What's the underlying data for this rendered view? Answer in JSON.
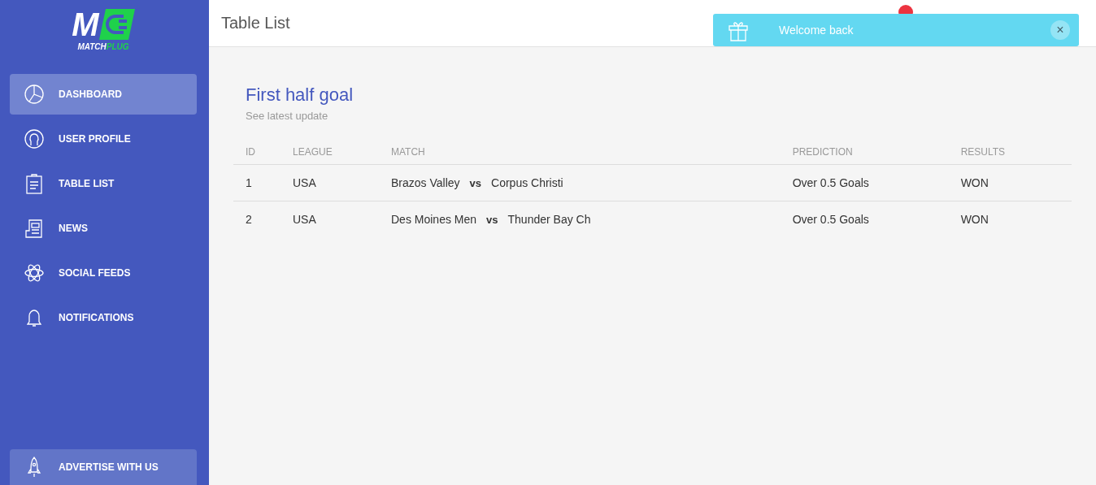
{
  "logo": {
    "mark": "M",
    "name_a": "MATCH",
    "name_b": "PLUG"
  },
  "sidebar": {
    "items": [
      {
        "label": "DASHBOARD",
        "kind": "chart",
        "selected": true
      },
      {
        "label": "USER PROFILE",
        "kind": "user",
        "selected": false
      },
      {
        "label": "TABLE LIST",
        "kind": "clipboard",
        "selected": false
      },
      {
        "label": "NEWS",
        "kind": "news",
        "selected": false
      },
      {
        "label": "SOCIAL FEEDS",
        "kind": "atom",
        "selected": false
      },
      {
        "label": "NOTIFICATIONS",
        "kind": "bell",
        "selected": false
      }
    ],
    "footer_button": {
      "label": "ADVERTISE WITH US"
    }
  },
  "header": {
    "title": "Table List"
  },
  "toast": {
    "message": "Welcome back",
    "close": "×"
  },
  "card": {
    "title": "First half goal",
    "subtitle": "See latest update",
    "table": {
      "columns": [
        "ID",
        "LEAGUE",
        "MATCH",
        "PREDICTION",
        "RESULTS"
      ],
      "rows": [
        {
          "id": "1",
          "league": "USA",
          "home": "Brazos Valley",
          "vs": "vs",
          "away": "Corpus Christi",
          "prediction": "Over 0.5 Goals",
          "result": "WON"
        },
        {
          "id": "2",
          "league": "USA",
          "home": "Des Moines Men",
          "vs": "vs",
          "away": "Thunder Bay Ch",
          "prediction": "Over 0.5 Goals",
          "result": "WON"
        }
      ]
    }
  }
}
